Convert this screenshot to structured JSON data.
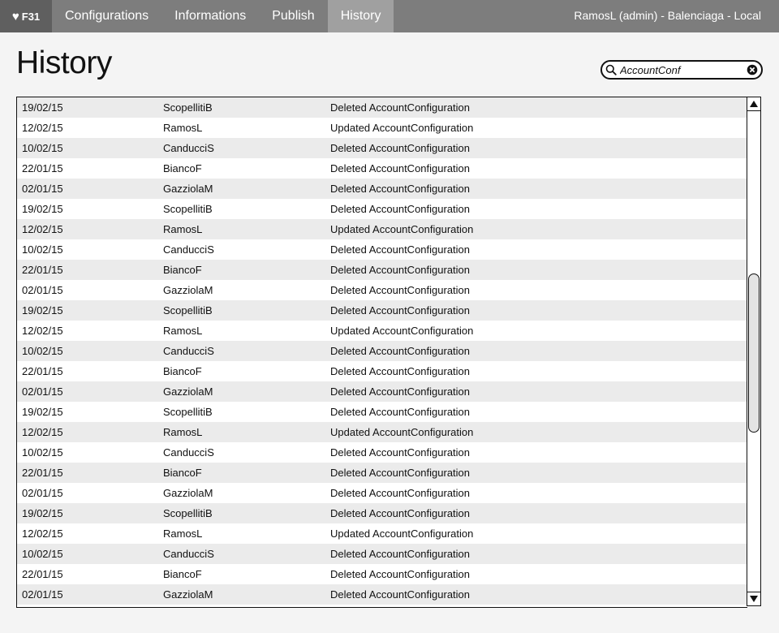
{
  "app": {
    "logo_text": "F31",
    "logo_icon": "heart-icon"
  },
  "nav": {
    "items": [
      {
        "label": "Configurations",
        "active": false
      },
      {
        "label": "Informations",
        "active": false
      },
      {
        "label": "Publish",
        "active": false
      },
      {
        "label": "History",
        "active": true
      }
    ]
  },
  "user": {
    "info": "RamosL (admin) - Balenciaga - Local"
  },
  "page": {
    "title": "History"
  },
  "search": {
    "value": "AccountConf",
    "icons": [
      "search-icon",
      "clear-icon"
    ]
  },
  "history": {
    "rows": [
      {
        "date": "19/02/15",
        "user": "ScopellitiB",
        "action": "Deleted AccountConfiguration"
      },
      {
        "date": "12/02/15",
        "user": "RamosL",
        "action": "Updated AccountConfiguration"
      },
      {
        "date": "10/02/15",
        "user": "CanducciS",
        "action": "Deleted AccountConfiguration"
      },
      {
        "date": "22/01/15",
        "user": "BiancoF",
        "action": "Deleted AccountConfiguration"
      },
      {
        "date": "02/01/15",
        "user": "GazziolaM",
        "action": "Deleted AccountConfiguration"
      },
      {
        "date": "19/02/15",
        "user": "ScopellitiB",
        "action": "Deleted AccountConfiguration"
      },
      {
        "date": "12/02/15",
        "user": "RamosL",
        "action": "Updated AccountConfiguration"
      },
      {
        "date": "10/02/15",
        "user": "CanducciS",
        "action": "Deleted AccountConfiguration"
      },
      {
        "date": "22/01/15",
        "user": "BiancoF",
        "action": "Deleted AccountConfiguration"
      },
      {
        "date": "02/01/15",
        "user": "GazziolaM",
        "action": "Deleted AccountConfiguration"
      },
      {
        "date": "19/02/15",
        "user": "ScopellitiB",
        "action": "Deleted AccountConfiguration"
      },
      {
        "date": "12/02/15",
        "user": "RamosL",
        "action": "Updated AccountConfiguration"
      },
      {
        "date": "10/02/15",
        "user": "CanducciS",
        "action": "Deleted AccountConfiguration"
      },
      {
        "date": "22/01/15",
        "user": "BiancoF",
        "action": "Deleted AccountConfiguration"
      },
      {
        "date": "02/01/15",
        "user": "GazziolaM",
        "action": "Deleted AccountConfiguration"
      },
      {
        "date": "19/02/15",
        "user": "ScopellitiB",
        "action": "Deleted AccountConfiguration"
      },
      {
        "date": "12/02/15",
        "user": "RamosL",
        "action": "Updated AccountConfiguration"
      },
      {
        "date": "10/02/15",
        "user": "CanducciS",
        "action": "Deleted AccountConfiguration"
      },
      {
        "date": "22/01/15",
        "user": "BiancoF",
        "action": "Deleted AccountConfiguration"
      },
      {
        "date": "02/01/15",
        "user": "GazziolaM",
        "action": "Deleted AccountConfiguration"
      },
      {
        "date": "19/02/15",
        "user": "ScopellitiB",
        "action": "Deleted AccountConfiguration"
      },
      {
        "date": "12/02/15",
        "user": "RamosL",
        "action": "Updated AccountConfiguration"
      },
      {
        "date": "10/02/15",
        "user": "CanducciS",
        "action": "Deleted AccountConfiguration"
      },
      {
        "date": "22/01/15",
        "user": "BiancoF",
        "action": "Deleted AccountConfiguration"
      },
      {
        "date": "02/01/15",
        "user": "GazziolaM",
        "action": "Deleted AccountConfiguration"
      }
    ]
  },
  "colors": {
    "topbar": "#7d7d7d",
    "logo_bg": "#5f5f5f",
    "active_tab": "#a0a0a0",
    "row_alt": "#ebebeb",
    "page_bg": "#f4f4f4"
  }
}
